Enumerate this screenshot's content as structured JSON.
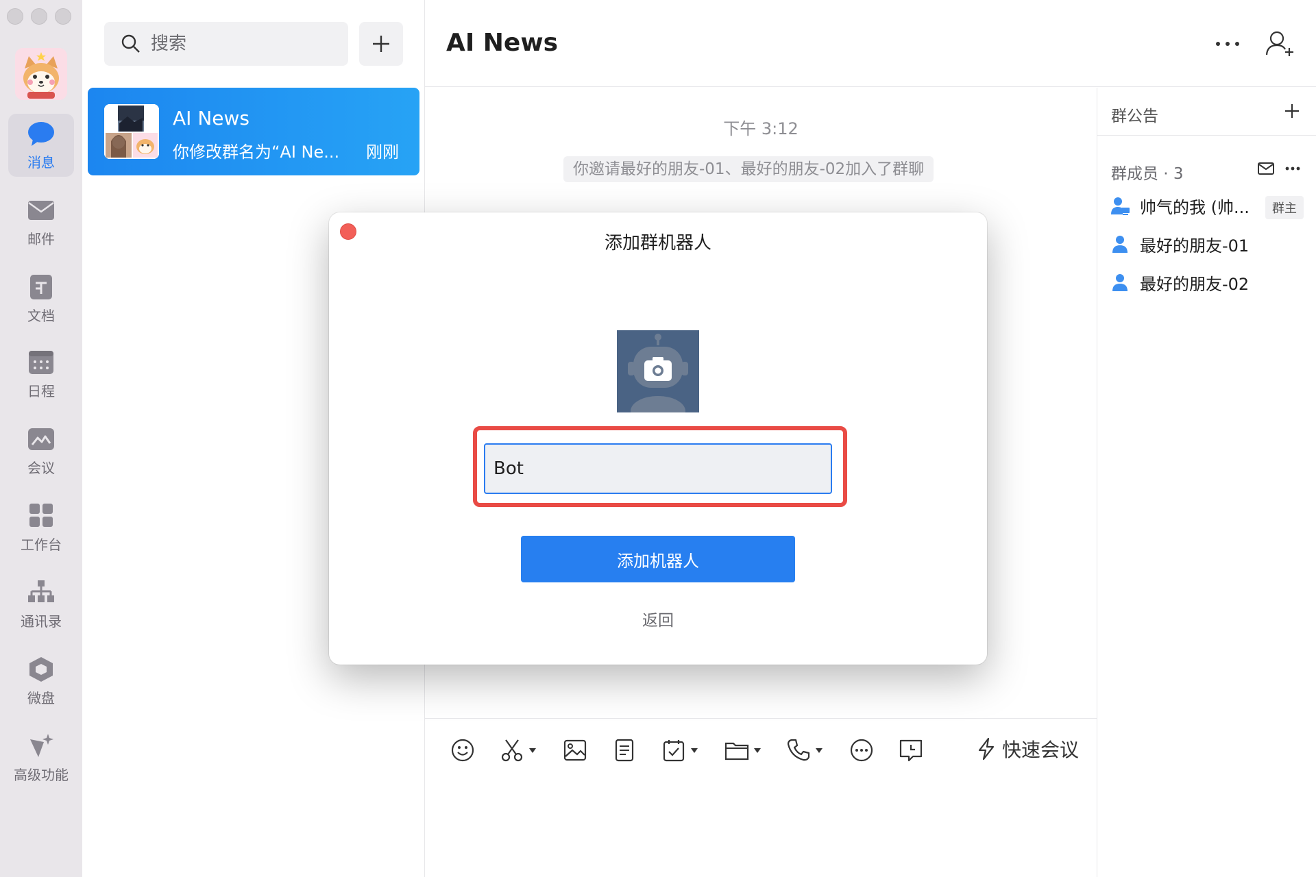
{
  "rail": {
    "items": [
      {
        "label": "消息",
        "icon": "chat-bubble-icon",
        "active": true
      },
      {
        "label": "邮件",
        "icon": "mail-icon"
      },
      {
        "label": "文档",
        "icon": "document-icon"
      },
      {
        "label": "日程",
        "icon": "calendar-icon"
      },
      {
        "label": "会议",
        "icon": "meeting-icon"
      },
      {
        "label": "工作台",
        "icon": "workbench-grid-icon"
      },
      {
        "label": "通讯录",
        "icon": "contacts-org-icon"
      },
      {
        "label": "微盘",
        "icon": "drive-icon"
      },
      {
        "label": "高级功能",
        "icon": "sparkle-icon"
      }
    ]
  },
  "list": {
    "search_placeholder": "搜索",
    "conversations": [
      {
        "title": "AI News",
        "preview": "你修改群名为“AI Ne...",
        "time": "刚刚",
        "selected": true
      }
    ]
  },
  "chat": {
    "title": "AI News",
    "timestamp": "下午 3:12",
    "system_message": "你邀请最好的朋友-01、最好的朋友-02加入了群聊",
    "toolbar": {
      "quick_meeting": "快速会议"
    }
  },
  "side": {
    "notice_label": "群公告",
    "members_label": "群成员 · 3",
    "members": [
      {
        "name": "帅气的我 (帅...",
        "badge": "群主"
      },
      {
        "name": "最好的朋友-01"
      },
      {
        "name": "最好的朋友-02"
      }
    ]
  },
  "modal": {
    "title": "添加群机器人",
    "name_value": "Bot",
    "submit_label": "添加机器人",
    "back_label": "返回"
  },
  "colors": {
    "accent": "#277ff0",
    "highlight": "#e94b45",
    "rail_bg": "#e9e6ea"
  }
}
